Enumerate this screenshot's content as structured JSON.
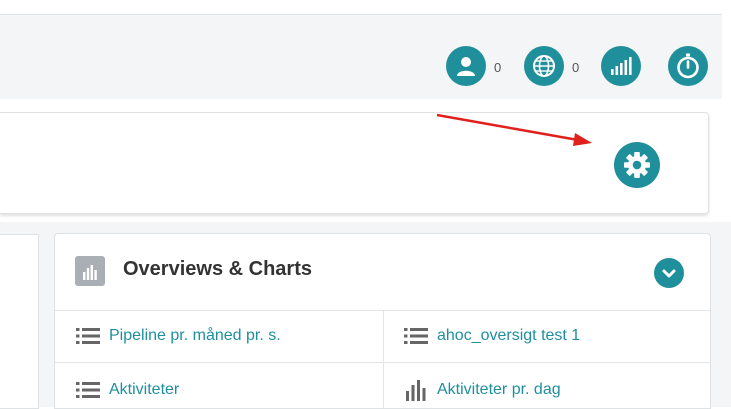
{
  "header": {
    "status": [
      {
        "icon": "user-icon",
        "count": "0"
      },
      {
        "icon": "globe-icon",
        "count": "0"
      },
      {
        "icon": "signal-bars-icon"
      },
      {
        "icon": "stopwatch-icon"
      }
    ]
  },
  "toolbar": {
    "settings_icon": "gear-icon"
  },
  "widget": {
    "title": "Overviews & Charts",
    "items": [
      {
        "label": "Pipeline pr. måned pr. s.",
        "icon": "list-icon"
      },
      {
        "label": "ahoc_oversigt test 1",
        "icon": "list-icon"
      },
      {
        "label": "Aktiviteter",
        "icon": "list-icon"
      },
      {
        "label": "Aktiviteter pr. dag",
        "icon": "bar-chart-icon"
      }
    ]
  },
  "colors": {
    "accent": "#1f8f9b",
    "link": "#1f8fa0",
    "annotation_arrow": "#e0201c"
  }
}
